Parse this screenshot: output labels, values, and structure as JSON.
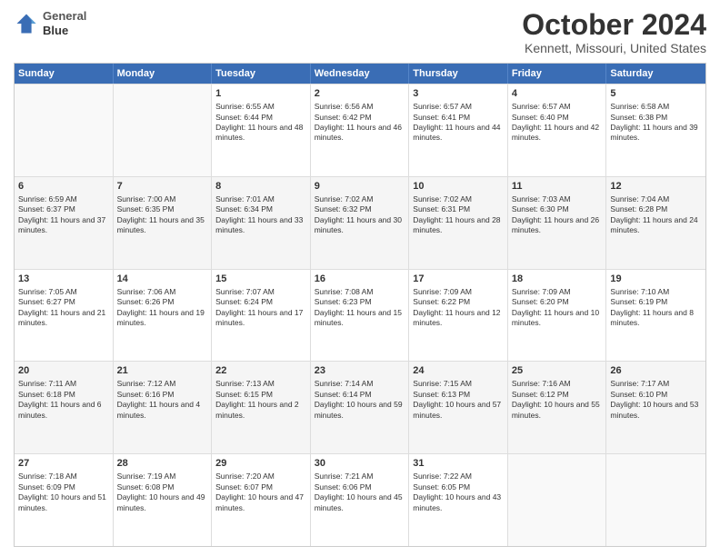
{
  "logo": {
    "line1": "General",
    "line2": "Blue"
  },
  "title": "October 2024",
  "subtitle": "Kennett, Missouri, United States",
  "days": [
    "Sunday",
    "Monday",
    "Tuesday",
    "Wednesday",
    "Thursday",
    "Friday",
    "Saturday"
  ],
  "weeks": [
    [
      {
        "day": "",
        "sunrise": "",
        "sunset": "",
        "daylight": "",
        "empty": true
      },
      {
        "day": "",
        "sunrise": "",
        "sunset": "",
        "daylight": "",
        "empty": true
      },
      {
        "day": "1",
        "sunrise": "Sunrise: 6:55 AM",
        "sunset": "Sunset: 6:44 PM",
        "daylight": "Daylight: 11 hours and 48 minutes."
      },
      {
        "day": "2",
        "sunrise": "Sunrise: 6:56 AM",
        "sunset": "Sunset: 6:42 PM",
        "daylight": "Daylight: 11 hours and 46 minutes."
      },
      {
        "day": "3",
        "sunrise": "Sunrise: 6:57 AM",
        "sunset": "Sunset: 6:41 PM",
        "daylight": "Daylight: 11 hours and 44 minutes."
      },
      {
        "day": "4",
        "sunrise": "Sunrise: 6:57 AM",
        "sunset": "Sunset: 6:40 PM",
        "daylight": "Daylight: 11 hours and 42 minutes."
      },
      {
        "day": "5",
        "sunrise": "Sunrise: 6:58 AM",
        "sunset": "Sunset: 6:38 PM",
        "daylight": "Daylight: 11 hours and 39 minutes."
      }
    ],
    [
      {
        "day": "6",
        "sunrise": "Sunrise: 6:59 AM",
        "sunset": "Sunset: 6:37 PM",
        "daylight": "Daylight: 11 hours and 37 minutes."
      },
      {
        "day": "7",
        "sunrise": "Sunrise: 7:00 AM",
        "sunset": "Sunset: 6:35 PM",
        "daylight": "Daylight: 11 hours and 35 minutes."
      },
      {
        "day": "8",
        "sunrise": "Sunrise: 7:01 AM",
        "sunset": "Sunset: 6:34 PM",
        "daylight": "Daylight: 11 hours and 33 minutes."
      },
      {
        "day": "9",
        "sunrise": "Sunrise: 7:02 AM",
        "sunset": "Sunset: 6:32 PM",
        "daylight": "Daylight: 11 hours and 30 minutes."
      },
      {
        "day": "10",
        "sunrise": "Sunrise: 7:02 AM",
        "sunset": "Sunset: 6:31 PM",
        "daylight": "Daylight: 11 hours and 28 minutes."
      },
      {
        "day": "11",
        "sunrise": "Sunrise: 7:03 AM",
        "sunset": "Sunset: 6:30 PM",
        "daylight": "Daylight: 11 hours and 26 minutes."
      },
      {
        "day": "12",
        "sunrise": "Sunrise: 7:04 AM",
        "sunset": "Sunset: 6:28 PM",
        "daylight": "Daylight: 11 hours and 24 minutes."
      }
    ],
    [
      {
        "day": "13",
        "sunrise": "Sunrise: 7:05 AM",
        "sunset": "Sunset: 6:27 PM",
        "daylight": "Daylight: 11 hours and 21 minutes."
      },
      {
        "day": "14",
        "sunrise": "Sunrise: 7:06 AM",
        "sunset": "Sunset: 6:26 PM",
        "daylight": "Daylight: 11 hours and 19 minutes."
      },
      {
        "day": "15",
        "sunrise": "Sunrise: 7:07 AM",
        "sunset": "Sunset: 6:24 PM",
        "daylight": "Daylight: 11 hours and 17 minutes."
      },
      {
        "day": "16",
        "sunrise": "Sunrise: 7:08 AM",
        "sunset": "Sunset: 6:23 PM",
        "daylight": "Daylight: 11 hours and 15 minutes."
      },
      {
        "day": "17",
        "sunrise": "Sunrise: 7:09 AM",
        "sunset": "Sunset: 6:22 PM",
        "daylight": "Daylight: 11 hours and 12 minutes."
      },
      {
        "day": "18",
        "sunrise": "Sunrise: 7:09 AM",
        "sunset": "Sunset: 6:20 PM",
        "daylight": "Daylight: 11 hours and 10 minutes."
      },
      {
        "day": "19",
        "sunrise": "Sunrise: 7:10 AM",
        "sunset": "Sunset: 6:19 PM",
        "daylight": "Daylight: 11 hours and 8 minutes."
      }
    ],
    [
      {
        "day": "20",
        "sunrise": "Sunrise: 7:11 AM",
        "sunset": "Sunset: 6:18 PM",
        "daylight": "Daylight: 11 hours and 6 minutes."
      },
      {
        "day": "21",
        "sunrise": "Sunrise: 7:12 AM",
        "sunset": "Sunset: 6:16 PM",
        "daylight": "Daylight: 11 hours and 4 minutes."
      },
      {
        "day": "22",
        "sunrise": "Sunrise: 7:13 AM",
        "sunset": "Sunset: 6:15 PM",
        "daylight": "Daylight: 11 hours and 2 minutes."
      },
      {
        "day": "23",
        "sunrise": "Sunrise: 7:14 AM",
        "sunset": "Sunset: 6:14 PM",
        "daylight": "Daylight: 10 hours and 59 minutes."
      },
      {
        "day": "24",
        "sunrise": "Sunrise: 7:15 AM",
        "sunset": "Sunset: 6:13 PM",
        "daylight": "Daylight: 10 hours and 57 minutes."
      },
      {
        "day": "25",
        "sunrise": "Sunrise: 7:16 AM",
        "sunset": "Sunset: 6:12 PM",
        "daylight": "Daylight: 10 hours and 55 minutes."
      },
      {
        "day": "26",
        "sunrise": "Sunrise: 7:17 AM",
        "sunset": "Sunset: 6:10 PM",
        "daylight": "Daylight: 10 hours and 53 minutes."
      }
    ],
    [
      {
        "day": "27",
        "sunrise": "Sunrise: 7:18 AM",
        "sunset": "Sunset: 6:09 PM",
        "daylight": "Daylight: 10 hours and 51 minutes."
      },
      {
        "day": "28",
        "sunrise": "Sunrise: 7:19 AM",
        "sunset": "Sunset: 6:08 PM",
        "daylight": "Daylight: 10 hours and 49 minutes."
      },
      {
        "day": "29",
        "sunrise": "Sunrise: 7:20 AM",
        "sunset": "Sunset: 6:07 PM",
        "daylight": "Daylight: 10 hours and 47 minutes."
      },
      {
        "day": "30",
        "sunrise": "Sunrise: 7:21 AM",
        "sunset": "Sunset: 6:06 PM",
        "daylight": "Daylight: 10 hours and 45 minutes."
      },
      {
        "day": "31",
        "sunrise": "Sunrise: 7:22 AM",
        "sunset": "Sunset: 6:05 PM",
        "daylight": "Daylight: 10 hours and 43 minutes."
      },
      {
        "day": "",
        "sunrise": "",
        "sunset": "",
        "daylight": "",
        "empty": true
      },
      {
        "day": "",
        "sunrise": "",
        "sunset": "",
        "daylight": "",
        "empty": true
      }
    ]
  ]
}
